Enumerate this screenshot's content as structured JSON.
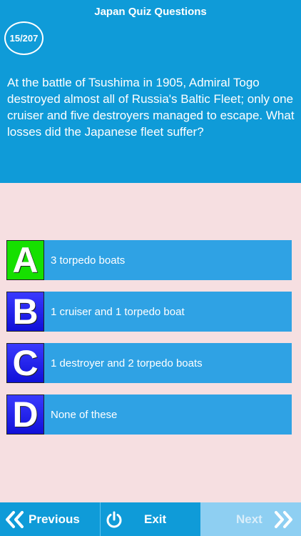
{
  "app": {
    "title": "Japan Quiz Questions"
  },
  "progress": {
    "label": "15/207",
    "current": 15,
    "total": 207
  },
  "question": {
    "text": "At the battle of Tsushima in 1905, Admiral Togo destroyed almost all of Russia's Baltic Fleet; only one cruiser and five destroyers managed to escape. What losses did the Japanese fleet suffer?"
  },
  "answers": [
    {
      "letter": "A",
      "text": "3 torpedo boats"
    },
    {
      "letter": "B",
      "text": "1 cruiser and 1 torpedo boat"
    },
    {
      "letter": "C",
      "text": "1 destroyer and 2 torpedo boats"
    },
    {
      "letter": "D",
      "text": "None of these"
    }
  ],
  "footer": {
    "previous": "Previous",
    "exit": "Exit",
    "next": "Next"
  },
  "colors": {
    "primary": "#0f9bd8",
    "answer_bg": "#2fa2e4",
    "correct": "#16e000",
    "letter_blue": "#1010d8",
    "page_bg": "#f6dfe1",
    "next_disabled": "#8ecff2"
  },
  "icons": {
    "previous": "double-chevron-left-icon",
    "exit": "power-icon",
    "next": "double-chevron-right-icon"
  }
}
